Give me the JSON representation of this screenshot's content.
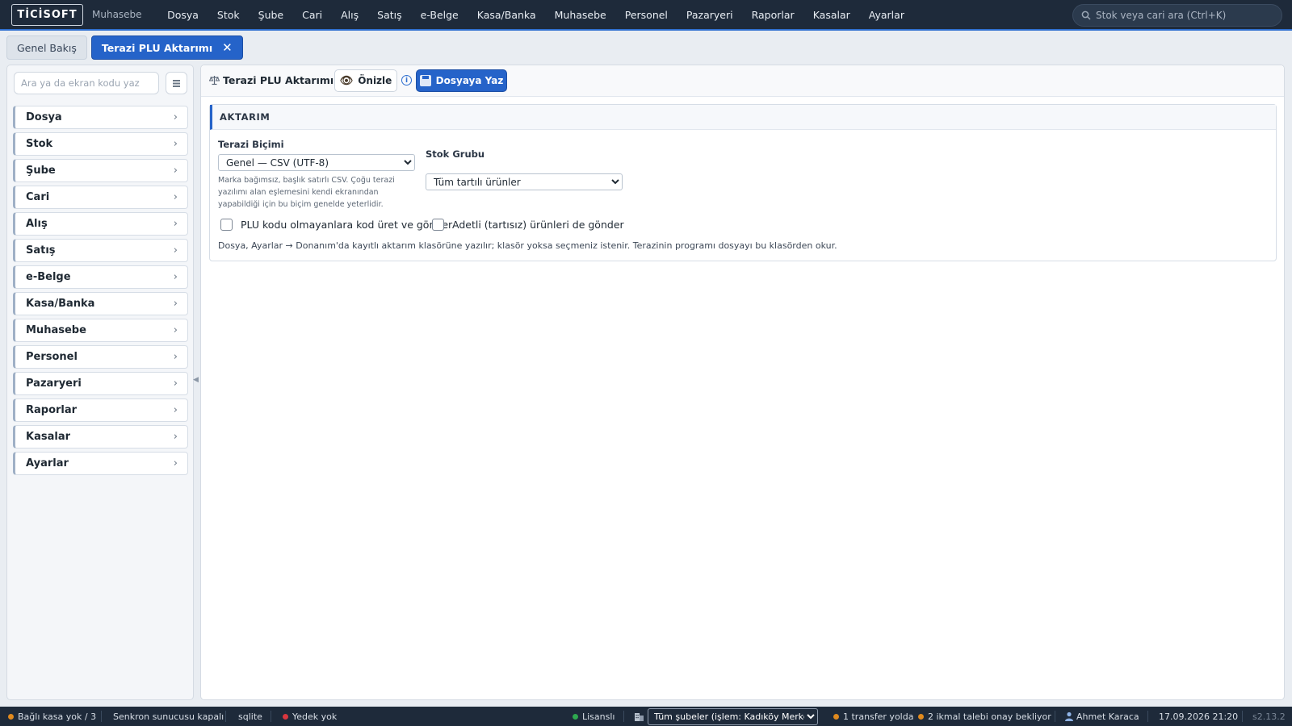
{
  "app": {
    "logo": "TİCİSOFT",
    "subtitle": "Muhasebe",
    "nav": [
      "Dosya",
      "Stok",
      "Şube",
      "Cari",
      "Alış",
      "Satış",
      "e-Belge",
      "Kasa/Banka",
      "Muhasebe",
      "Personel",
      "Pazaryeri",
      "Raporlar",
      "Kasalar",
      "Ayarlar"
    ],
    "search_placeholder": "Stok veya cari ara (Ctrl+K)"
  },
  "tabs": {
    "overview": "Genel Bakış",
    "active": "Terazi PLU Aktarımı",
    "close_glyph": "✕"
  },
  "sidebar": {
    "search_placeholder": "Ara ya da ekran kodu yaz",
    "items": [
      "Dosya",
      "Stok",
      "Şube",
      "Cari",
      "Alış",
      "Satış",
      "e-Belge",
      "Kasa/Banka",
      "Muhasebe",
      "Personel",
      "Pazaryeri",
      "Raporlar",
      "Kasalar",
      "Ayarlar"
    ]
  },
  "toolbar": {
    "title": "Terazi PLU Aktarımı",
    "preview_label": "Önizle",
    "write_label": "Dosyaya Yaz",
    "info_glyph": "i"
  },
  "form": {
    "section_title": "AKTARIM",
    "format_label": "Terazi Biçimi",
    "format_value": "Genel — CSV (UTF-8)",
    "format_hint": "Marka bağımsız, başlık satırlı CSV. Çoğu terazi yazılımı alan eşlemesini kendi ekranından yapabildiği için bu biçim genelde yeterlidir.",
    "group_label": "Stok Grubu",
    "group_value": "Tüm tartılı ürünler",
    "check1_label": "PLU kodu olmayanlara kod üret ve gönder",
    "check1_checked": false,
    "check2_label": "Adetli (tartısız) ürünleri de gönder",
    "check2_checked": false,
    "note": "Dosya, Ayarlar → Donanım'da kayıtlı aktarım klasörüne yazılır; klasör yoksa seçmeniz istenir. Terazinin programı dosyayı bu klasörden okur."
  },
  "status": {
    "pos": "Bağlı kasa yok / 3",
    "sync": "Senkron sunucusu kapalı",
    "db": "sqlite",
    "backup": "Yedek yok",
    "license": "Lisanslı",
    "branch": "Tüm şubeler (işlem: Kadıköy Merkez)",
    "transfer": "1 transfer yolda",
    "requests": "2 ikmal talebi onay bekliyor",
    "user": "Ahmet Karaca",
    "datetime": "17.09.2026 21:20",
    "version": "s2.13.2"
  },
  "colors": {
    "topbar": "#1e2a3a",
    "accent": "#2563c9",
    "status_ok": "#2ea84f",
    "status_warn": "#e08a1e",
    "status_error": "#d9363e"
  },
  "icons": {
    "search": "search-icon",
    "scale": "scale-icon",
    "eye": "eye-icon",
    "save": "floppy-disk-icon",
    "info": "info-icon",
    "chevron": "chevron-right-icon",
    "grid": "grid-icon",
    "building": "building-icon",
    "user": "user-icon"
  }
}
